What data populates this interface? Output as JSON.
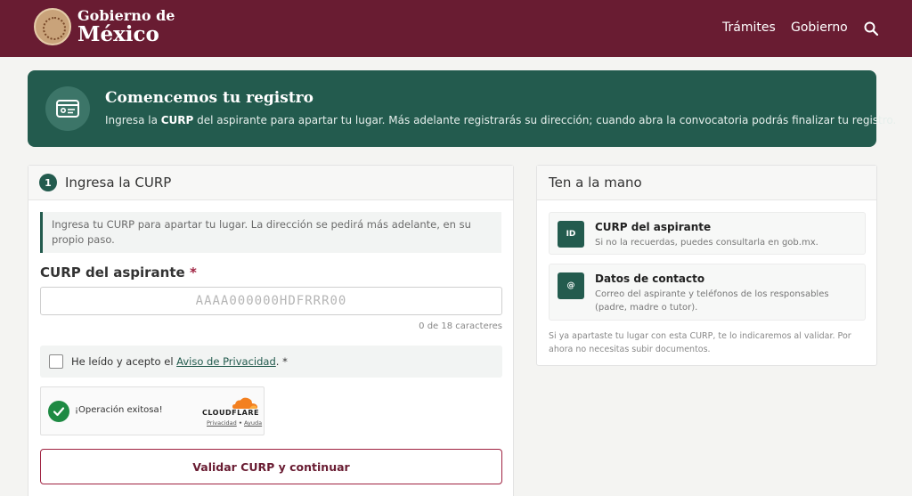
{
  "header": {
    "brand_line1": "Gobierno de",
    "brand_line2": "México",
    "nav": [
      "Trámites",
      "Gobierno"
    ]
  },
  "banner": {
    "title": "Comencemos tu registro",
    "text_pre": "Ingresa la ",
    "text_bold": "CURP",
    "text_post": " del aspirante para apartar tu lugar. Más adelante registrarás su dirección; cuando abra la convocatoria podrás finalizar tu registro."
  },
  "step": {
    "number": "1",
    "title": "Ingresa la CURP",
    "info": "Ingresa tu CURP para apartar tu lugar. La dirección se pedirá más adelante, en su propio paso.",
    "field_label": "CURP del aspirante",
    "required_mark": "*",
    "curp_value": "",
    "curp_placeholder": "AAAA000000HDFRRR00",
    "counter": "0 de 18 caracteres",
    "privacy_pre": "He leído y acepto el ",
    "privacy_link": "Aviso de Privacidad",
    "privacy_post": ". *",
    "captcha_status": "¡Operación exitosa!",
    "captcha_brand": "CLOUDFLARE",
    "captcha_privacy": "Privacidad",
    "captcha_sep": "•",
    "captcha_help": "Ayuda",
    "submit_label": "Validar CURP y continuar"
  },
  "sidebar": {
    "title": "Ten a la mano",
    "items": [
      {
        "icon": "ID",
        "title": "CURP del aspirante",
        "desc": "Si no la recuerdas, puedes consultarla en gob.mx."
      },
      {
        "icon": "@",
        "title": "Datos de contacto",
        "desc": "Correo del aspirante y teléfonos de los responsables (padre, madre o tutor)."
      }
    ],
    "note": "Si ya apartaste tu lugar con esta CURP, te lo indicaremos al validar. Por ahora no necesitas subir documentos."
  },
  "colors": {
    "header_bg": "#691c32",
    "primary_green": "#235b4e",
    "accent_red": "#9f2241"
  }
}
